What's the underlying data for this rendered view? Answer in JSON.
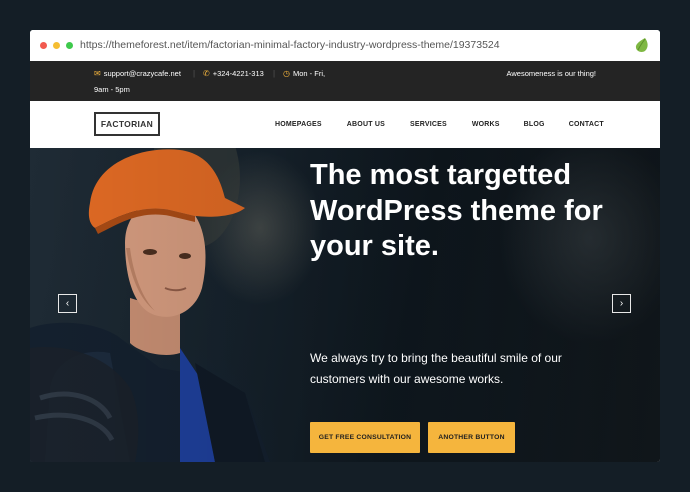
{
  "browser": {
    "url": "https://themeforest.net/item/factorian-minimal-factory-industry-wordpress-theme/19373524",
    "icon": "envato-leaf-icon"
  },
  "topbar": {
    "email": "support@crazycafe.net",
    "phone": "+324-4221-313",
    "hours_line1": "Mon - Fri,",
    "hours_line2": "9am - 5pm",
    "tagline": "Awesomeness is our thing!",
    "icons": [
      "envelope-icon",
      "phone-icon",
      "clock-icon"
    ],
    "icon_color": "#f5b53d"
  },
  "nav": {
    "logo": "FACTORIAN",
    "items": [
      "HOMEPAGES",
      "ABOUT US",
      "SERVICES",
      "WORKS",
      "BLOG",
      "CONTACT"
    ]
  },
  "hero": {
    "title": "The most targetted WordPress theme for your site.",
    "subtitle": "We always try to bring the beautiful smile of our customers with our awesome works.",
    "primary_button": "GET FREE CONSULTATION",
    "secondary_button": "ANOTHER BUTTON",
    "prev_arrow": "‹",
    "next_arrow": "›",
    "accent_color": "#f5b53d"
  }
}
